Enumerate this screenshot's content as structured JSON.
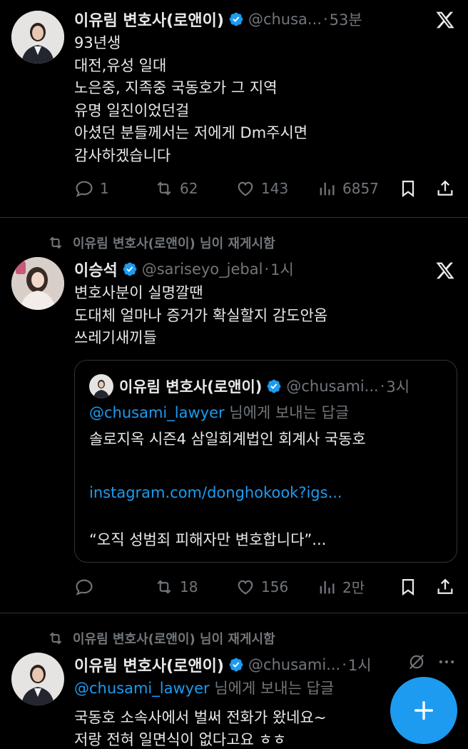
{
  "tweets": [
    {
      "name": "이유림 변호사(로앤이)",
      "handle": "@chusa...",
      "time": "53분",
      "lines": [
        "93년생",
        "대전,유성 일대",
        "노은중, 지족중 국동호가 그 지역",
        "유명 일진이었던걸",
        "아셨던 분들께서는 저에게 Dm주시면",
        "감사하겠습니다"
      ],
      "replies": "1",
      "retweets": "62",
      "likes": "143",
      "views": "6857"
    },
    {
      "retweeted_by": "이유림 변호사(로앤이) 님이 재게시함",
      "name": "이승석",
      "handle": "@sariseyo_jebal",
      "time": "1시",
      "lines": [
        "변호사분이 실명깔땐",
        "도대체 얼마나 증거가 확실할지 감도안옴",
        "쓰레기새끼들"
      ],
      "quote": {
        "name": "이유림 변호사(로앤이)",
        "handle": "@chusami...",
        "time": "3시",
        "reply_to_mention": "@chusami_lawyer",
        "reply_to_suffix": " 님에게 보내는 답글",
        "line1": "솔로지옥 시즌4 삼일회계법인 회계사 국동호",
        "link": "instagram.com/donghokook?igs...",
        "line3": "“오직 성범죄 피해자만 변호합니다”..."
      },
      "replies": "",
      "retweets": "18",
      "likes": "156",
      "views": "2만"
    },
    {
      "retweeted_by": "이유림 변호사(로앤이) 님이 재게시함",
      "name": "이유림 변호사(로앤이)",
      "handle": "@chusami...",
      "time": "1시",
      "reply_to_mention": "@chusami_lawyer",
      "reply_to_suffix": " 님에게 보내는 답글",
      "lines": [
        "국동호 소속사에서 벌써 전화가 왔네요~",
        "저랑 전혀 일면식이 없다고요 ㅎㅎ"
      ]
    }
  ],
  "separator": "·",
  "icons": {
    "reply": "reply-icon",
    "retweet": "retweet-icon",
    "like": "heart-icon",
    "views": "views-icon",
    "bookmark": "bookmark-icon",
    "share": "share-icon",
    "grok": "grok-icon",
    "more": "more-icon",
    "x": "x-logo-icon",
    "compose": "compose-plus-icon"
  },
  "colors": {
    "background": "#000000",
    "text": "#e7e9ea",
    "muted": "#71767b",
    "accent": "#1d9bf0",
    "divider": "#2f3336"
  }
}
